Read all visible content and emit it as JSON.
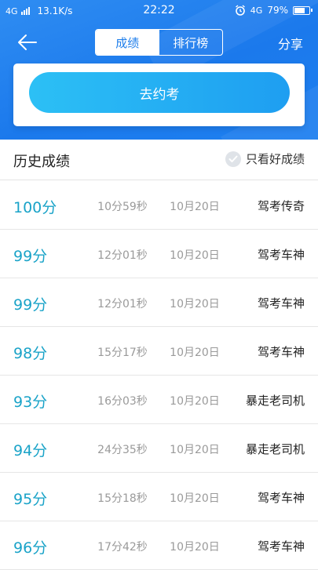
{
  "status_bar": {
    "network": "4G",
    "speed": "13.1K/s",
    "time": "22:22",
    "network_right": "4G",
    "battery": "79%",
    "battery_level": 0.79
  },
  "nav": {
    "tabs": [
      {
        "label": "成绩",
        "active": true
      },
      {
        "label": "排行榜",
        "active": false
      }
    ],
    "share_label": "分享"
  },
  "card": {
    "button_label": "去约考"
  },
  "section": {
    "title": "历史成绩",
    "filter_label": "只看好成绩"
  },
  "scores": [
    {
      "score": "100分",
      "duration": "10分59秒",
      "date": "10月20日",
      "title": "驾考传奇"
    },
    {
      "score": "99分",
      "duration": "12分01秒",
      "date": "10月20日",
      "title": "驾考车神"
    },
    {
      "score": "99分",
      "duration": "12分01秒",
      "date": "10月20日",
      "title": "驾考车神"
    },
    {
      "score": "98分",
      "duration": "15分17秒",
      "date": "10月20日",
      "title": "驾考车神"
    },
    {
      "score": "93分",
      "duration": "16分03秒",
      "date": "10月20日",
      "title": "暴走老司机"
    },
    {
      "score": "94分",
      "duration": "24分35秒",
      "date": "10月20日",
      "title": "暴走老司机"
    },
    {
      "score": "95分",
      "duration": "15分18秒",
      "date": "10月20日",
      "title": "驾考车神"
    },
    {
      "score": "96分",
      "duration": "17分42秒",
      "date": "10月20日",
      "title": "驾考车神"
    }
  ],
  "colors": {
    "header_blue": "#1e7eeb",
    "score_cyan": "#1aa3c8",
    "button_start": "#2cc0f5",
    "button_end": "#1e9ef1"
  }
}
